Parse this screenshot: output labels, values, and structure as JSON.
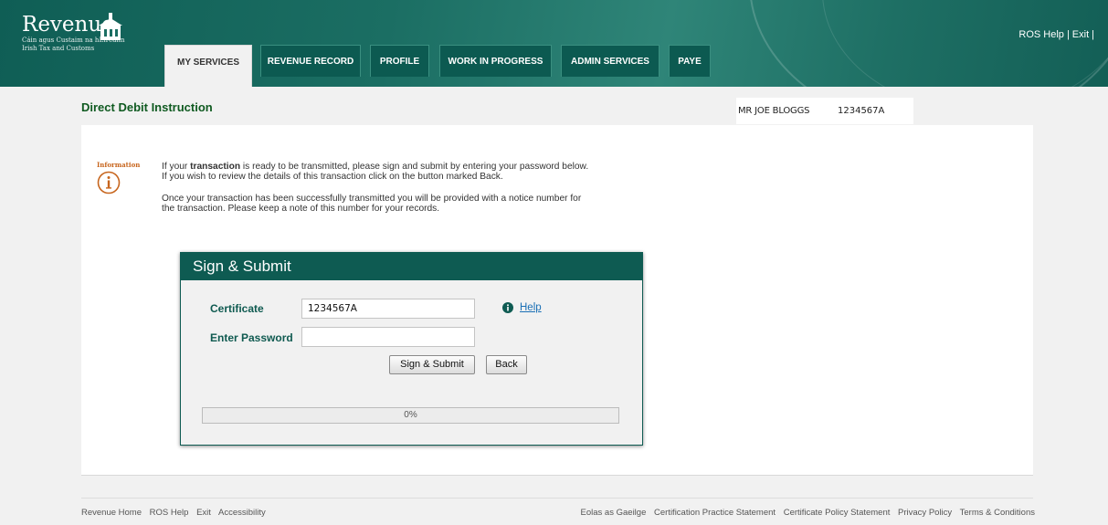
{
  "brand": {
    "name": "Revenue",
    "subtitle_line1": "Cáin agus Custaim na hÉireann",
    "subtitle_line2": "Irish Tax and Customs"
  },
  "top_links": {
    "help": "ROS Help",
    "exit": "Exit"
  },
  "tabs": [
    {
      "label": "MY SERVICES",
      "active": true
    },
    {
      "label": "REVENUE RECORD"
    },
    {
      "label": "PROFILE"
    },
    {
      "label": "WORK IN PROGRESS"
    },
    {
      "label": "ADMIN SERVICES"
    },
    {
      "label": "PAYE"
    }
  ],
  "page": {
    "title": "Direct Debit Instruction"
  },
  "user": {
    "name": "MR JOE BLOGGS",
    "id": "1234567A"
  },
  "info": {
    "label": "Information",
    "line1_before": "If your ",
    "line1_bold": "transaction",
    "line1_after": " is ready to be transmitted, please sign and submit by entering your password below.",
    "line2": "If you wish to review the details of this transaction click on the button marked Back.",
    "line3": "Once your transaction has been successfully transmitted you will be provided with a notice number for",
    "line4": "the transaction. Please keep a note of this number for your records."
  },
  "dialog": {
    "title": "Sign & Submit",
    "certificate_label": "Certificate",
    "certificate_value": "1234567A",
    "password_label": "Enter Password",
    "password_value": "",
    "help_label": "Help",
    "submit_label": "Sign & Submit",
    "back_label": "Back",
    "progress_text": "0%",
    "progress_value": 0
  },
  "footer": {
    "left": [
      "Revenue Home",
      "ROS Help",
      "Exit",
      "Accessibility"
    ],
    "right": [
      "Eolas as Gaeilge",
      "Certification Practice Statement",
      "Certificate Policy Statement",
      "Privacy Policy",
      "Terms & Conditions"
    ]
  },
  "colors": {
    "header": "#1b6e63",
    "tab": "#0c5a51",
    "title_green": "#0f5a20",
    "info_orange": "#c7651d",
    "link_blue": "#1a6fb5"
  }
}
